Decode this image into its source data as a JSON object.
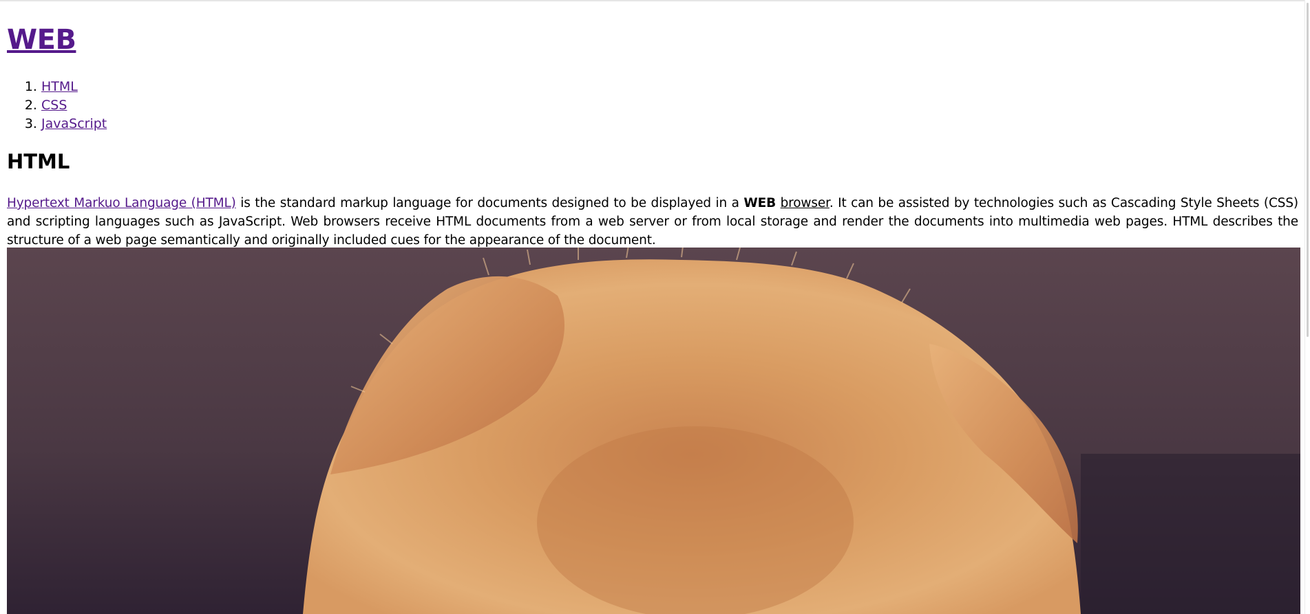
{
  "page": {
    "title_link": "WEB",
    "nav": [
      {
        "label": "HTML"
      },
      {
        "label": "CSS"
      },
      {
        "label": "JavaScript"
      }
    ],
    "section_heading": "HTML",
    "paragraph": {
      "link_text": "Hypertext Markuo Language (HTML)",
      "text_1": " is the standard markup language for documents designed to be displayed in a ",
      "bold_text": "WEB",
      "text_2": " ",
      "browser_link": "browser",
      "text_3": ". It can be assisted by technologies such as Cascading Style Sheets (CSS) and scripting languages such as JavaScript. Web browsers receive HTML documents from a web server or from local storage and render the documents into multimedia web pages. HTML describes the structure of a web page semantically and originally included cues for the appearance of the document."
    },
    "image": {
      "icon": "kitten-photo"
    }
  },
  "colors": {
    "link": "#551a8b",
    "background": "#ffffff",
    "image_backdrop": "#4a3843",
    "cat_fur": "#d9975a"
  }
}
